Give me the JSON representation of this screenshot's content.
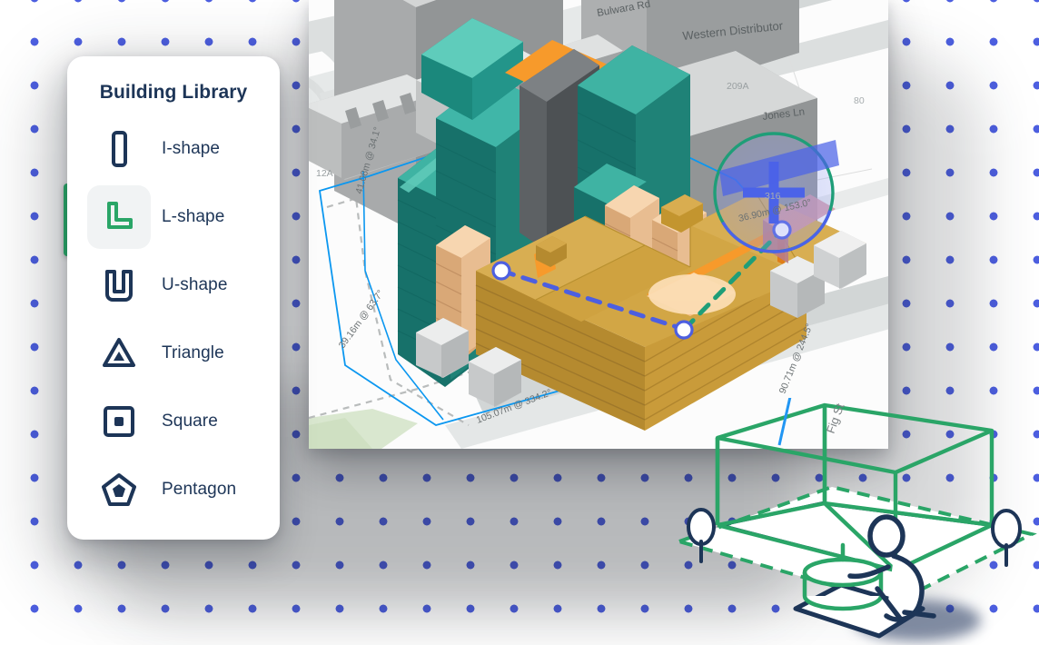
{
  "app": {
    "title": "Building Library"
  },
  "sidebar": {
    "title": "Building Library",
    "accent_color": "#2aa567",
    "text_color": "#1d3557",
    "selected_index": 1,
    "items": [
      {
        "label": "I-shape",
        "icon": "i-shape-icon",
        "selected": false
      },
      {
        "label": "L-shape",
        "icon": "l-shape-icon",
        "selected": true
      },
      {
        "label": "U-shape",
        "icon": "u-shape-icon",
        "selected": false
      },
      {
        "label": "Triangle",
        "icon": "triangle-icon",
        "selected": false
      },
      {
        "label": "Square",
        "icon": "square-icon",
        "selected": false
      },
      {
        "label": "Pentagon",
        "icon": "pentagon-icon",
        "selected": false
      }
    ]
  },
  "map": {
    "street_labels": [
      "Bulwara Rd",
      "Western Distributor",
      "Jones Ln",
      "Fig St"
    ],
    "parcel_labels": [
      "209A",
      "80",
      "316",
      "12A"
    ],
    "measurements": [
      "36.90m @ 153.0°",
      "105.07m @ 334.2°",
      "90.71m @ 244.5°",
      "41.08m @ 34.1°",
      "39.16m @ 63.7°"
    ],
    "colors": {
      "proposed_building": "#cfa240",
      "context_building": "#1f8277",
      "highlight_roof": "#f79a2b",
      "site_boundary": "#0b97f0",
      "measure_line": "#4d5fe0",
      "selection_circle": "#3b5bdb",
      "accent_green": "#2aa567",
      "ground": "#ffffff"
    },
    "cursor_readout": "36.90m @ 153.0°"
  },
  "illustration": {
    "name": "3d-massing-sketch",
    "street_label": "Fig St",
    "box_color": "#2aa567",
    "outline_color": "#1d3557"
  },
  "background": {
    "dot_color": "#4d5fe0",
    "dot_spacing_px": 48
  }
}
